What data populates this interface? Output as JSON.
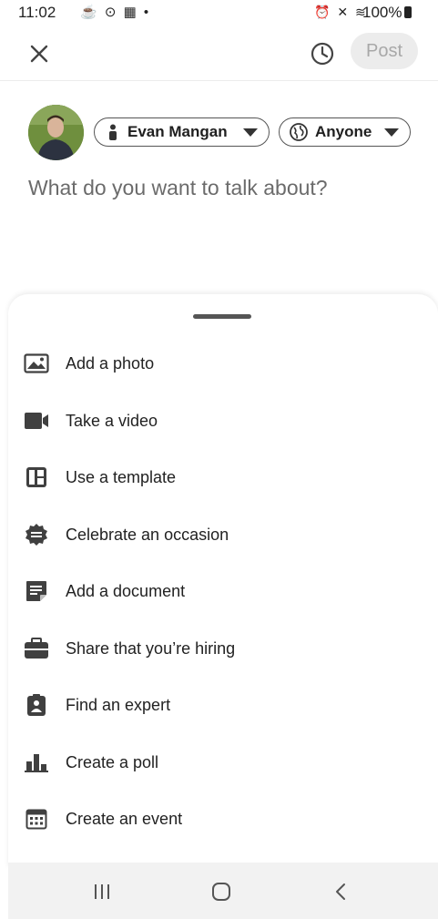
{
  "status_bar": {
    "time": "11:02",
    "left_icons": "☕ ⊙ ▦ •",
    "right_icons": "⏰ ✕ ≋",
    "battery": "100%"
  },
  "top_bar": {
    "close_icon": "close-icon",
    "schedule_icon": "clock-icon",
    "post_label": "Post"
  },
  "author": {
    "name": "Evan Mangan",
    "audience": "Anyone"
  },
  "composer": {
    "placeholder": "What do you want to talk about?"
  },
  "actions": [
    {
      "label": "Add a photo",
      "icon": "photo-icon"
    },
    {
      "label": "Take a video",
      "icon": "video-icon"
    },
    {
      "label": "Use a template",
      "icon": "template-icon"
    },
    {
      "label": "Celebrate an occasion",
      "icon": "celebrate-icon"
    },
    {
      "label": "Add a document",
      "icon": "document-icon"
    },
    {
      "label": "Share that you’re hiring",
      "icon": "briefcase-icon"
    },
    {
      "label": "Find an expert",
      "icon": "expert-icon"
    },
    {
      "label": "Create a poll",
      "icon": "poll-icon"
    },
    {
      "label": "Create an event",
      "icon": "calendar-icon"
    }
  ],
  "nav_bar": {
    "recents": "recents-icon",
    "home": "home-icon",
    "back": "back-icon"
  },
  "colors": {
    "post_disabled_bg": "#ececec",
    "post_disabled_text": "#a8a8a8",
    "icon": "#404040",
    "placeholder": "#6b6b6b"
  }
}
